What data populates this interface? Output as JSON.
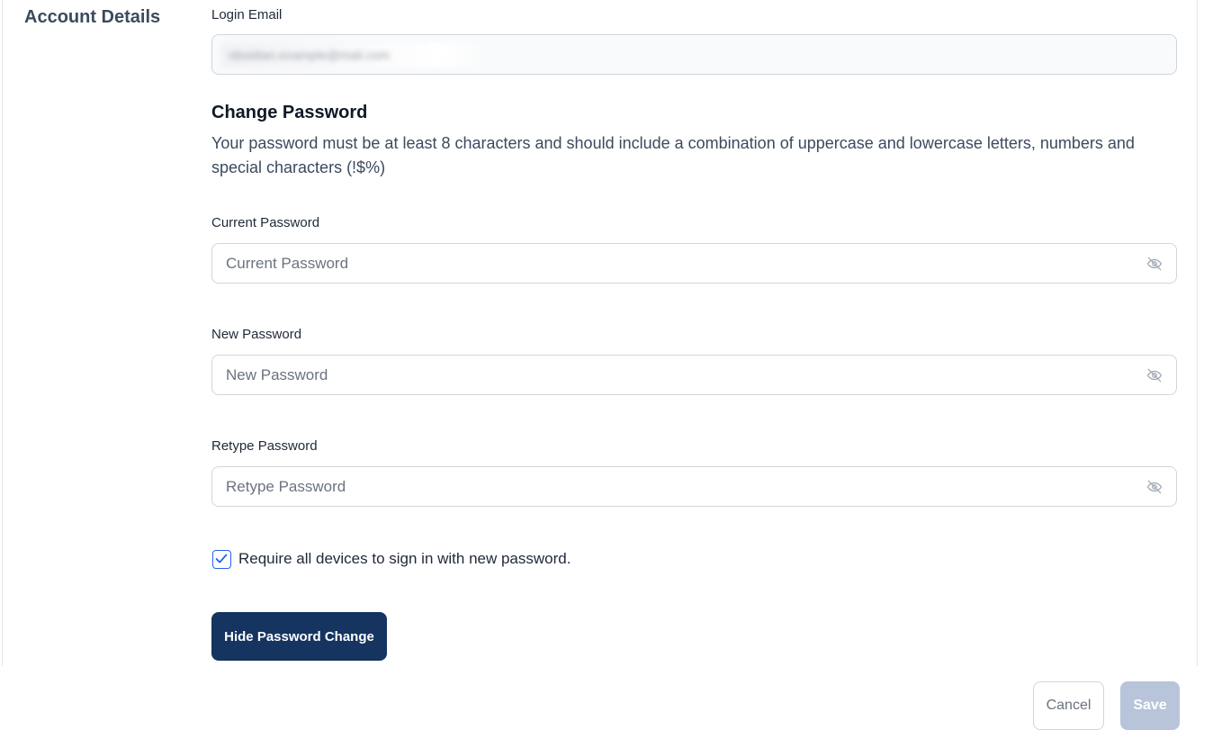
{
  "section": {
    "title": "Account Details"
  },
  "login_email": {
    "label": "Login Email",
    "value_blurred": "obsidian.example@mail.com"
  },
  "change_password": {
    "title": "Change Password",
    "description": "Your password must be at least 8 characters and should include a combination of uppercase and lowercase letters, numbers and special characters (!$%)"
  },
  "fields": {
    "current": {
      "label": "Current Password",
      "placeholder": "Current Password",
      "icon": "eye-off-icon"
    },
    "new": {
      "label": "New Password",
      "placeholder": "New Password",
      "icon": "eye-off-icon"
    },
    "retype": {
      "label": "Retype Password",
      "placeholder": "Retype Password",
      "icon": "eye-off-icon"
    }
  },
  "require_signin": {
    "label": "Require all devices to sign in with new password.",
    "checked": true
  },
  "buttons": {
    "toggle": "Hide Password Change",
    "cancel": "Cancel",
    "save": "Save"
  },
  "colors": {
    "primary": "#153460",
    "save_disabled": "#b8c4d9",
    "checkbox_accent": "#2563eb"
  }
}
